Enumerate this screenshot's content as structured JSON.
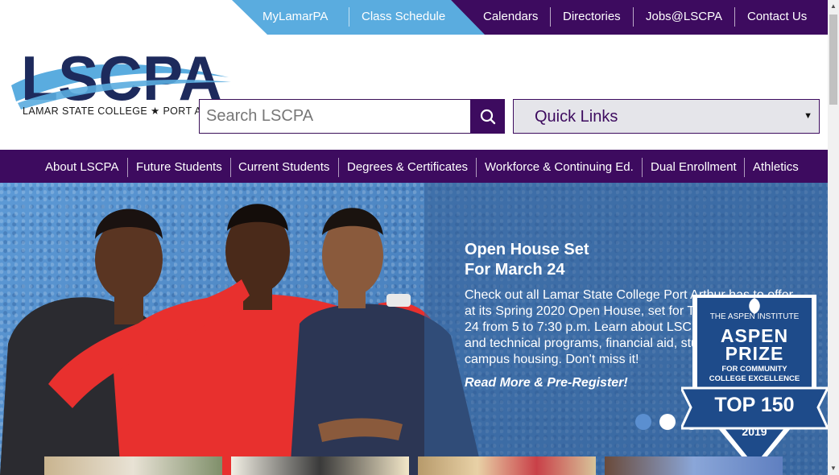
{
  "utility_nav": {
    "left_links": [
      "MyLamarPA",
      "Class Schedule"
    ],
    "right_links": [
      "Calendars",
      "Directories",
      "Jobs@LSCPA",
      "Contact Us"
    ]
  },
  "logo": {
    "wordmark": "LSCPA",
    "tagline": "LAMAR STATE COLLEGE ★ PORT ARTHUR"
  },
  "search": {
    "placeholder": "Search LSCPA",
    "value": ""
  },
  "quick_links": {
    "selected": "Quick Links"
  },
  "main_nav": {
    "items": [
      "About LSCPA",
      "Future Students",
      "Current Students",
      "Degrees & Certificates",
      "Workforce & Continuing Ed.",
      "Dual Enrollment",
      "Athletics"
    ]
  },
  "hero": {
    "title_line1": "Open House Set",
    "title_line2": "For March 24",
    "body": "Check out all Lamar State College Port Arthur has to offer at its Spring 2020 Open House, set for Tuesday, March 24 from 5 to 7:30 p.m. Learn about LSCPA's academic and technical programs, financial aid, student life and campus housing. Don't miss it!",
    "cta": "Read More & Pre-Register!",
    "slide_count": 3,
    "active_slide": 1
  },
  "badge": {
    "org": "THE ASPEN INSTITUTE",
    "line1": "ASPEN",
    "line2": "PRIZE",
    "line3": "FOR COMMUNITY",
    "line4": "COLLEGE EXCELLENCE",
    "rank": "TOP 150",
    "year": "2019"
  },
  "colors": {
    "purple": "#3d0b5f",
    "light_blue": "#5aacdf",
    "navy": "#1d2a5c"
  }
}
